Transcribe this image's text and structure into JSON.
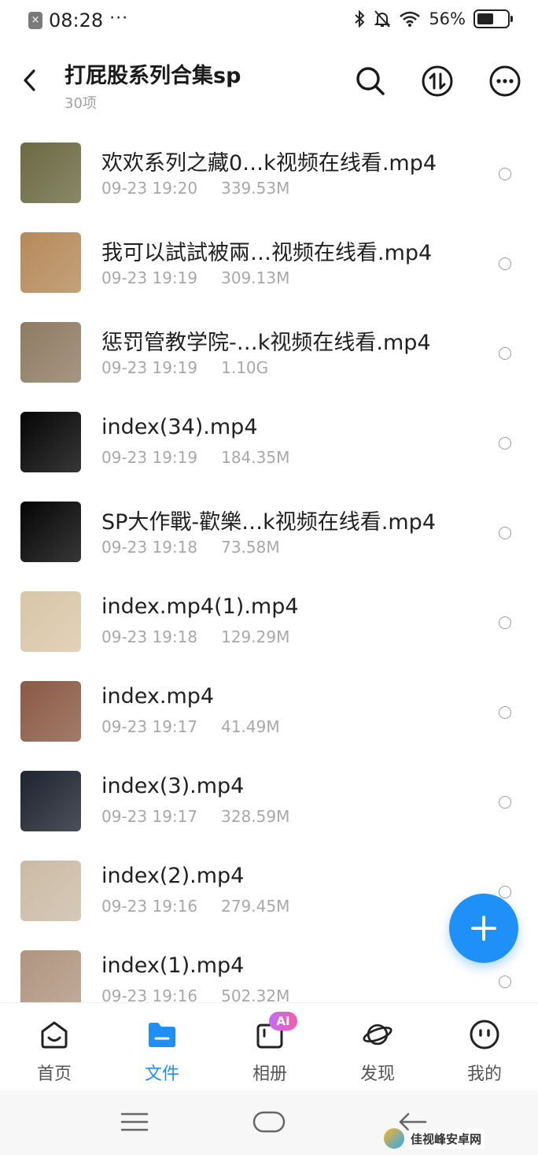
{
  "status_bar": {
    "time": "08:28",
    "dots": "···",
    "battery_percent": "56%",
    "battery_level": 0.56
  },
  "header": {
    "title": "打屁股系列合集sp",
    "subtitle": "30项",
    "icons": [
      "back-icon",
      "search-icon",
      "sort-icon",
      "more-icon"
    ]
  },
  "files": [
    {
      "name": "欢欢系列之藏0…k视频在线看.mp4",
      "date": "09-23 19:20",
      "size": "339.53M",
      "thumb_color": "#6b6a42"
    },
    {
      "name": "我可以試試被兩…视频在线看.mp4",
      "date": "09-23 19:19",
      "size": "309.13M",
      "thumb_color": "#b58a5a"
    },
    {
      "name": "惩罚管教学院-…k视频在线看.mp4",
      "date": "09-23 19:19",
      "size": "1.10G",
      "thumb_color": "#8f7b63"
    },
    {
      "name": "index(34).mp4",
      "date": "09-23 19:19",
      "size": "184.35M",
      "thumb_color": "#050505"
    },
    {
      "name": "SP大作戰-歡樂…k视频在线看.mp4",
      "date": "09-23 19:18",
      "size": "73.58M",
      "thumb_color": "#050505"
    },
    {
      "name": "index.mp4(1).mp4",
      "date": "09-23 19:18",
      "size": "129.29M",
      "thumb_color": "#d9c6a8"
    },
    {
      "name": "index.mp4",
      "date": "09-23 19:17",
      "size": "41.49M",
      "thumb_color": "#8a5a45"
    },
    {
      "name": "index(3).mp4",
      "date": "09-23 19:17",
      "size": "328.59M",
      "thumb_color": "#1e2430"
    },
    {
      "name": "index(2).mp4",
      "date": "09-23 19:16",
      "size": "279.45M",
      "thumb_color": "#cbbba5"
    },
    {
      "name": "index(1).mp4",
      "date": "09-23 19:16",
      "size": "502.32M",
      "thumb_color": "#b09580"
    }
  ],
  "fab": {
    "icon": "plus-icon"
  },
  "tabs": [
    {
      "label": "首页",
      "icon": "home-icon",
      "active": false
    },
    {
      "label": "文件",
      "icon": "folder-icon",
      "active": true
    },
    {
      "label": "相册",
      "icon": "album-icon",
      "active": false,
      "badge": "AI"
    },
    {
      "label": "发现",
      "icon": "planet-icon",
      "active": false
    },
    {
      "label": "我的",
      "icon": "profile-icon",
      "active": false
    }
  ],
  "watermark": {
    "text": "佳视峰安卓网"
  },
  "colors": {
    "accent": "#1f8ff7",
    "fab": "#1f90f8",
    "meta_text": "#a8a8a8"
  }
}
